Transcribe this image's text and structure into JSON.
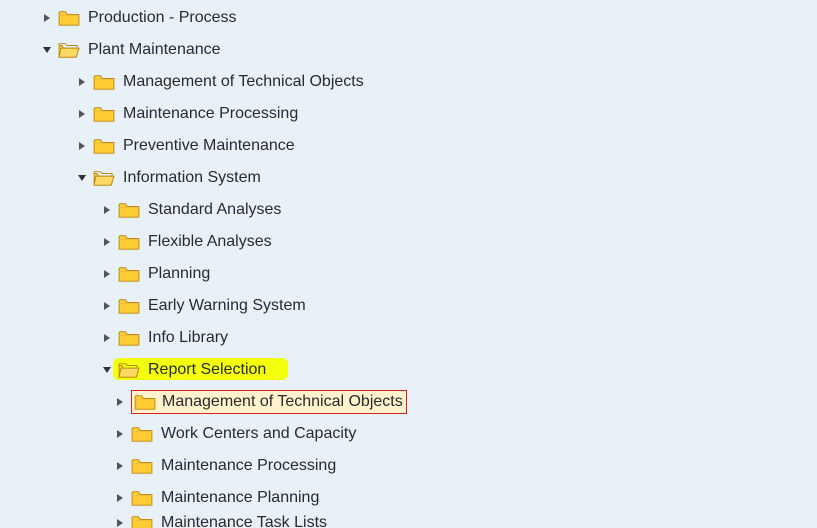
{
  "tree": {
    "production_process": "Production - Process",
    "plant_maintenance": "Plant Maintenance",
    "pm_mto": "Management of Technical Objects",
    "pm_mp": "Maintenance Processing",
    "pm_pm": "Preventive Maintenance",
    "info_system": "Information System",
    "is_std": "Standard Analyses",
    "is_flex": "Flexible Analyses",
    "is_plan": "Planning",
    "is_ews": "Early Warning System",
    "is_lib": "Info Library",
    "report_selection": "Report Selection",
    "rs_mto": "Management of Technical Objects",
    "rs_wcc": "Work Centers and Capacity",
    "rs_mp": "Maintenance Processing",
    "rs_mplan": "Maintenance Planning",
    "rs_mtl_partial": "Maintenance Task Lists"
  }
}
